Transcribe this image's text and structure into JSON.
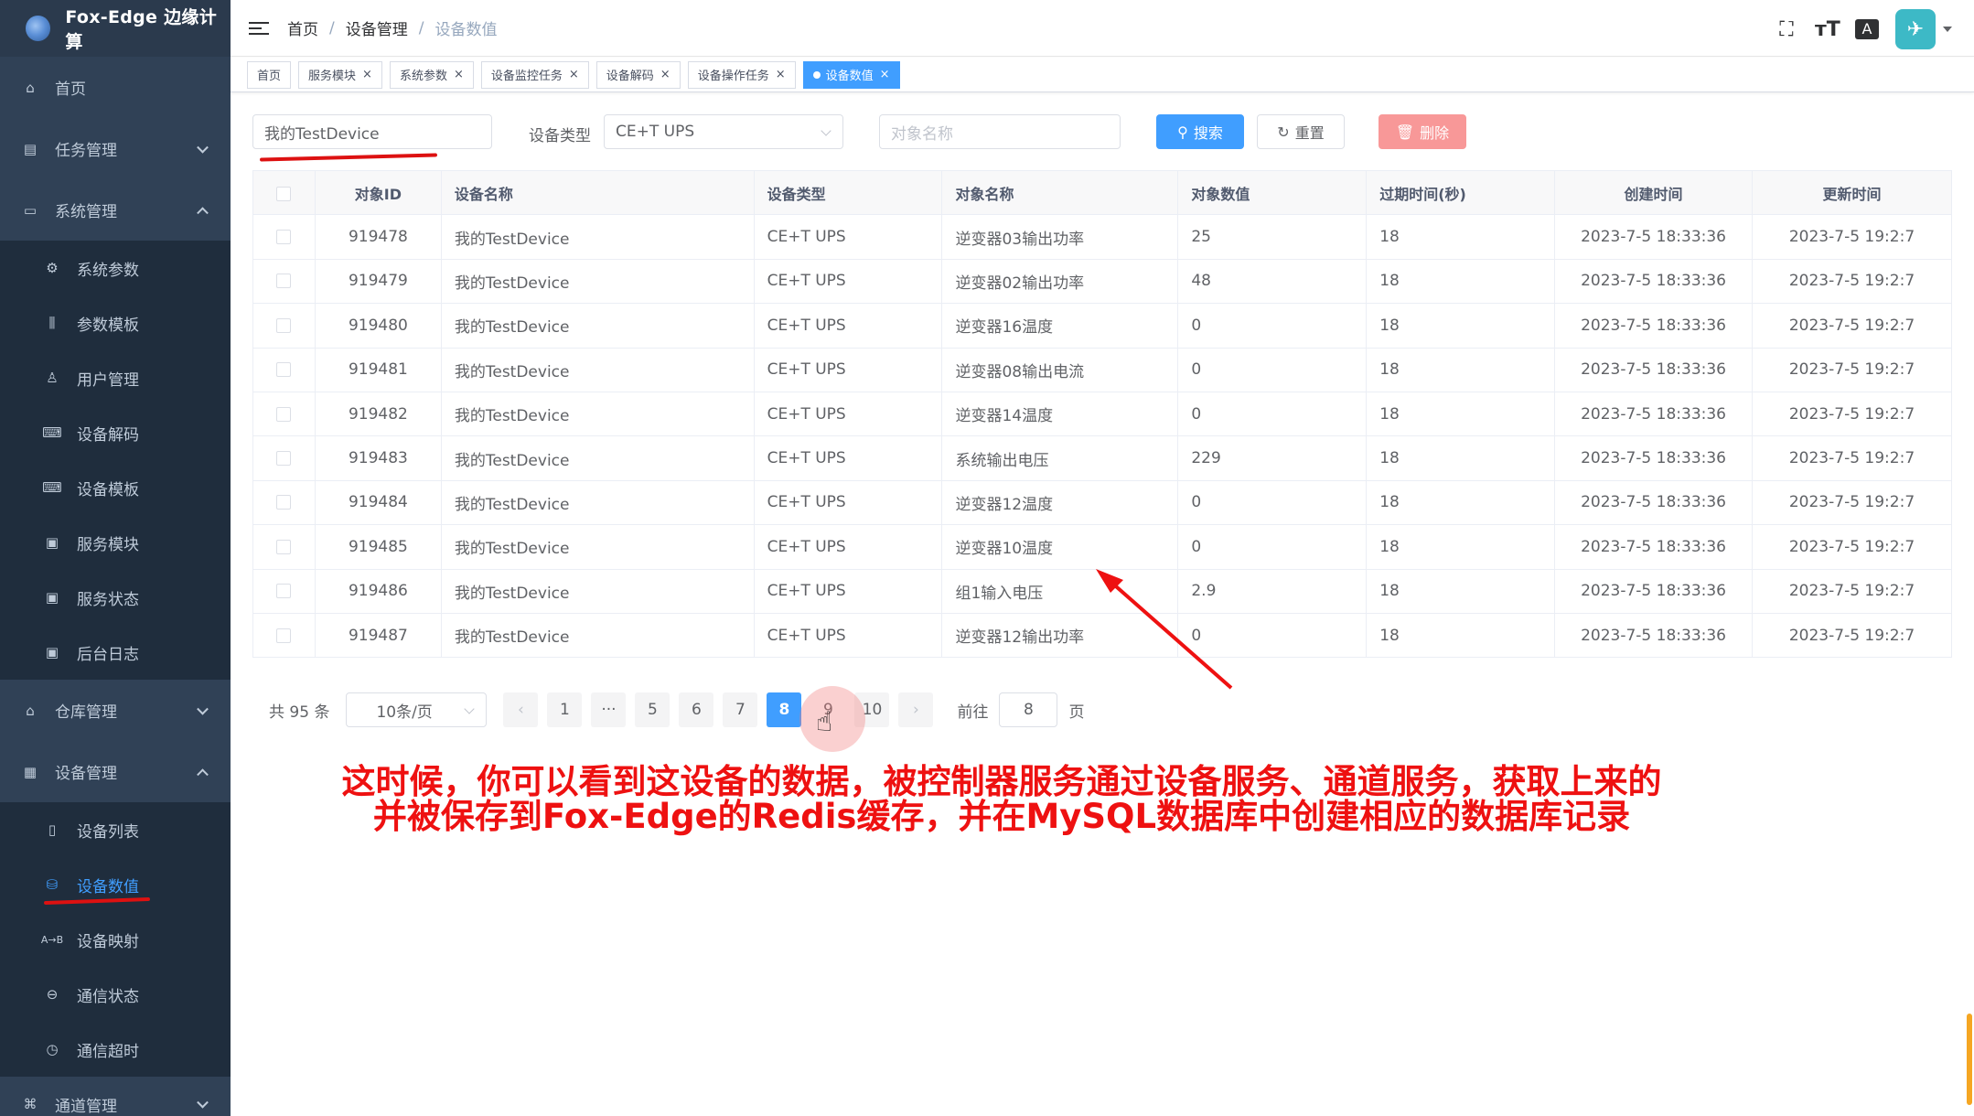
{
  "app": {
    "title": "Fox-Edge 边缘计算"
  },
  "sidebar": {
    "items": [
      {
        "label": "首页",
        "icon": "home-icon"
      },
      {
        "label": "任务管理",
        "icon": "task-icon"
      },
      {
        "label": "系统管理",
        "icon": "system-icon"
      }
    ],
    "system_sub": [
      "系统参数",
      "参数模板",
      "用户管理",
      "设备解码",
      "设备模板",
      "服务模块",
      "服务状态",
      "后台日志"
    ],
    "warehouse": "仓库管理",
    "device_mgmt": "设备管理",
    "device_sub": [
      "设备列表",
      "设备数值",
      "设备映射",
      "通信状态",
      "通信超时"
    ],
    "channel_mgmt": "通道管理"
  },
  "breadcrumb": {
    "home": "首页",
    "sep1": "/",
    "level1": "设备管理",
    "sep2": "/",
    "current": "设备数值"
  },
  "tags": [
    "首页",
    "服务模块",
    "系统参数",
    "设备监控任务",
    "设备解码",
    "设备操作任务",
    "设备数值"
  ],
  "tag_close": "×",
  "search": {
    "device_name_value": "我的TestDevice",
    "device_type_label": "设备类型",
    "device_type_value": "CE+T UPS",
    "object_name_placeholder": "对象名称",
    "search_label": "搜索",
    "reset_label": "重置",
    "delete_label": "删除"
  },
  "table": {
    "headers": [
      "对象ID",
      "设备名称",
      "设备类型",
      "对象名称",
      "对象数值",
      "过期时间(秒)",
      "创建时间",
      "更新时间"
    ],
    "rows": [
      [
        "919478",
        "我的TestDevice",
        "CE+T UPS",
        "逆变器03输出功率",
        "25",
        "18",
        "2023-7-5 18:33:36",
        "2023-7-5 19:2:7"
      ],
      [
        "919479",
        "我的TestDevice",
        "CE+T UPS",
        "逆变器02输出功率",
        "48",
        "18",
        "2023-7-5 18:33:36",
        "2023-7-5 19:2:7"
      ],
      [
        "919480",
        "我的TestDevice",
        "CE+T UPS",
        "逆变器16温度",
        "0",
        "18",
        "2023-7-5 18:33:36",
        "2023-7-5 19:2:7"
      ],
      [
        "919481",
        "我的TestDevice",
        "CE+T UPS",
        "逆变器08输出电流",
        "0",
        "18",
        "2023-7-5 18:33:36",
        "2023-7-5 19:2:7"
      ],
      [
        "919482",
        "我的TestDevice",
        "CE+T UPS",
        "逆变器14温度",
        "0",
        "18",
        "2023-7-5 18:33:36",
        "2023-7-5 19:2:7"
      ],
      [
        "919483",
        "我的TestDevice",
        "CE+T UPS",
        "系统输出电压",
        "229",
        "18",
        "2023-7-5 18:33:36",
        "2023-7-5 19:2:7"
      ],
      [
        "919484",
        "我的TestDevice",
        "CE+T UPS",
        "逆变器12温度",
        "0",
        "18",
        "2023-7-5 18:33:36",
        "2023-7-5 19:2:7"
      ],
      [
        "919485",
        "我的TestDevice",
        "CE+T UPS",
        "逆变器10温度",
        "0",
        "18",
        "2023-7-5 18:33:36",
        "2023-7-5 19:2:7"
      ],
      [
        "919486",
        "我的TestDevice",
        "CE+T UPS",
        "组1输入电压",
        "2.9",
        "18",
        "2023-7-5 18:33:36",
        "2023-7-5 19:2:7"
      ],
      [
        "919487",
        "我的TestDevice",
        "CE+T UPS",
        "逆变器12输出功率",
        "0",
        "18",
        "2023-7-5 18:33:36",
        "2023-7-5 19:2:7"
      ]
    ]
  },
  "pagination": {
    "total": "共 95 条",
    "page_size": "10条/页",
    "prev": "‹",
    "next": "›",
    "pages": [
      "1",
      "···",
      "5",
      "6",
      "7",
      "8",
      "9",
      "10"
    ],
    "current": "8",
    "goto_label": "前往",
    "goto_value": "8",
    "goto_suffix": "页"
  },
  "annotation": {
    "line1": "这时候，你可以看到这设备的数据，被控制器服务通过设备服务、通道服务，获取上来的",
    "line2": "并被保存到Fox-Edge的Redis缓存，并在MySQL数据库中创建相应的数据库记录"
  },
  "colors": {
    "sidebar": "#304156",
    "accent": "#409eff",
    "annotation": "#ee1111",
    "danger": "#f89898"
  }
}
